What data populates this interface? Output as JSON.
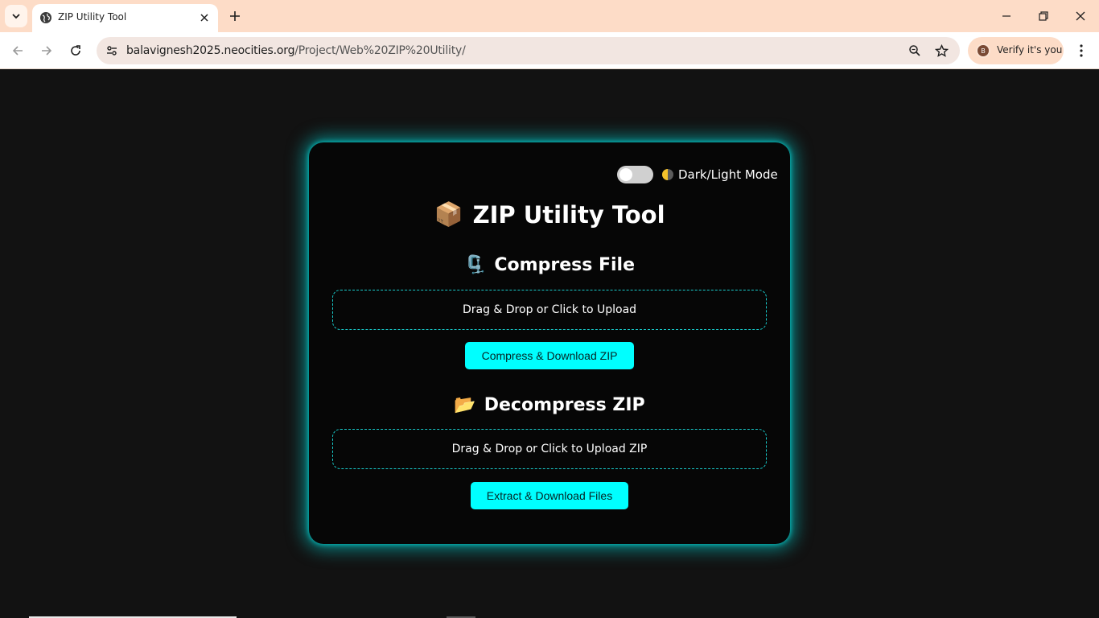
{
  "browser": {
    "tab": {
      "title": "ZIP Utility Tool"
    },
    "url": {
      "host": "balavignesh2025.neocities.org",
      "path": "/Project/Web%20ZIP%20Utility/"
    },
    "profile": {
      "initial": "B",
      "label": "Verify it's you"
    },
    "colors": {
      "tabbar": "#fddcc7",
      "omnibox": "#f2e6e1"
    }
  },
  "page": {
    "theme_toggle": {
      "label": "Dark/Light Mode",
      "state": "off"
    },
    "title": {
      "emoji": "📦",
      "text": "ZIP Utility Tool"
    },
    "compress": {
      "emoji": "🗜️",
      "heading": "Compress File",
      "dropzone": "Drag & Drop or Click to Upload",
      "button": "Compress & Download ZIP"
    },
    "decompress": {
      "emoji": "📂",
      "heading": "Decompress ZIP",
      "dropzone": "Drag & Drop or Click to Upload ZIP",
      "button": "Extract & Download Files"
    },
    "colors": {
      "accent": "#00ffff",
      "card": "#060606",
      "background": "#121212"
    }
  }
}
